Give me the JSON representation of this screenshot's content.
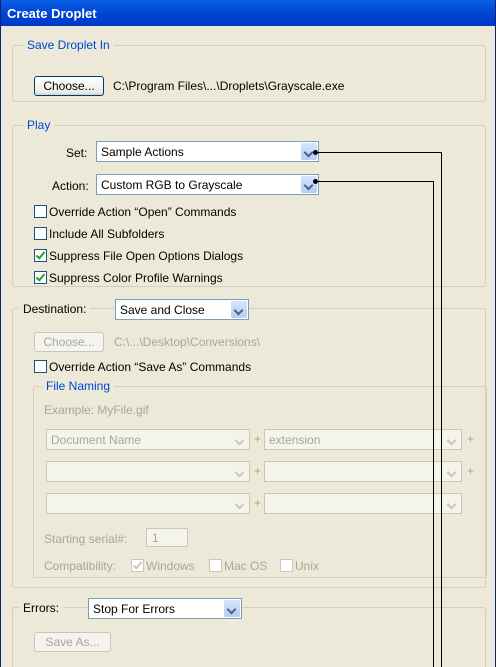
{
  "window": {
    "title": "Create Droplet"
  },
  "save_in": {
    "legend": "Save Droplet In",
    "choose_label": "Choose...",
    "path": "C:\\Program Files\\...\\Droplets\\Grayscale.exe"
  },
  "play": {
    "legend": "Play",
    "set_label": "Set:",
    "set_value": "Sample Actions",
    "action_label": "Action:",
    "action_value": "Custom RGB to Grayscale",
    "checkboxes": [
      {
        "label": "Override Action “Open” Commands",
        "checked": false
      },
      {
        "label": "Include All Subfolders",
        "checked": false
      },
      {
        "label": "Suppress File Open Options Dialogs",
        "checked": true
      },
      {
        "label": "Suppress Color Profile Warnings",
        "checked": true
      }
    ]
  },
  "destination": {
    "label": "Destination:",
    "value": "Save and Close",
    "choose_label": "Choose...",
    "path": "C:\\...\\Desktop\\Conversions\\",
    "override_label": "Override Action “Save As” Commands",
    "file_naming": {
      "legend": "File Naming",
      "example": "Example: MyFile.gif",
      "rows": [
        [
          "Document Name",
          "extension"
        ],
        [
          "",
          ""
        ],
        [
          "",
          ""
        ]
      ],
      "plus": "+",
      "serial_label": "Starting serial#:",
      "serial_value": "1",
      "compat_label": "Compatibility:",
      "compat_options": [
        {
          "label": "Windows",
          "checked": true
        },
        {
          "label": "Mac OS",
          "checked": false
        },
        {
          "label": "Unix",
          "checked": false
        }
      ]
    }
  },
  "errors": {
    "label": "Errors:",
    "value": "Stop For Errors",
    "save_as_label": "Save As..."
  },
  "colors": {
    "title_bar": "#0046d5",
    "legend_text": "#0046d5",
    "dialog_bg": "#ece9d8",
    "disabled_text": "#a7a69b"
  }
}
